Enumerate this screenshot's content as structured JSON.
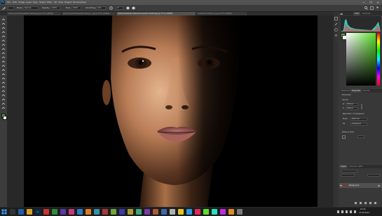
{
  "app": {
    "logo": "Ps"
  },
  "menu": [
    "File",
    "Edit",
    "Image",
    "Layer",
    "Type",
    "Select",
    "Filter",
    "3D",
    "View",
    "Plugins",
    "Window",
    "Help"
  ],
  "window_controls": {
    "minimize": "—",
    "maximize": "❐",
    "close": "✕"
  },
  "options": {
    "mode_label": "Mode:",
    "mode_value": "Normal",
    "opacity_label": "Opacity:",
    "opacity_value": "100%",
    "flow_label": "Flow:",
    "flow_value": "100%",
    "smoothing_label": "Smoothing:",
    "smoothing_value": "10%",
    "angle_value": "0°"
  },
  "tabs": [
    {
      "label": "woman-portrait-beautiful-makeup.jpg @ 33.3% (RGB/8)",
      "active": false
    },
    {
      "label": "woman-portrait-beautiful-makeup-...jpg @ 33.3% (RGB/8)",
      "active": false
    },
    {
      "label": "ledanovi-bezarta-model-stunning-face-shadow.jpg @ 33.3% (RGB/8)",
      "active": true
    },
    {
      "label": "model-face-shadow...jpg @ 33.3% (RGB/8)",
      "active": false
    }
  ],
  "panels": {
    "top_tabs": [
      "Color",
      "Swatches"
    ],
    "histogram_color": "#2fd0c0",
    "props_tabs": [
      "Adjustments",
      "Properties",
      "Libraries"
    ],
    "props_title": "Document",
    "canvas_section": "Canvas",
    "w_label": "W",
    "h_label": "H",
    "w_value": "2000 px",
    "h_value": "3000 px",
    "resolution_label": "Resolution: 72 pixels/inch",
    "mode_label": "Mode",
    "mode_value": "RGB Color",
    "fill_label": "Fill",
    "fill_value": "Transparent",
    "rulers_section": "Rulers & Grids",
    "layers_tabs": [
      "Layers",
      "Channels",
      "Paths"
    ],
    "layer_name": "Background"
  },
  "taskbar": {
    "time": "10:42",
    "date": "23-08-2023"
  }
}
